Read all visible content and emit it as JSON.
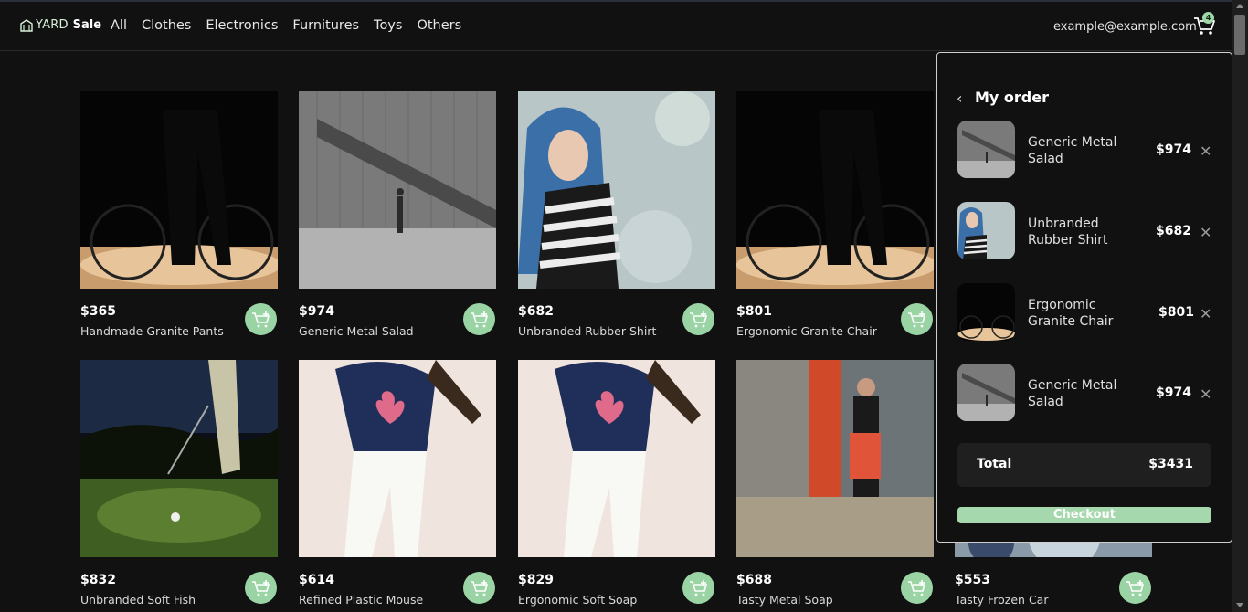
{
  "header": {
    "logo_yard": "YARD",
    "logo_sale": "Sale",
    "nav": [
      "All",
      "Clothes",
      "Electronics",
      "Furnitures",
      "Toys",
      "Others"
    ],
    "email": "example@example.com",
    "cart_count": "4"
  },
  "products": [
    {
      "price": "$365",
      "name": "Handmade Granite Pants",
      "image": "bike"
    },
    {
      "price": "$974",
      "name": "Generic Metal Salad",
      "image": "street"
    },
    {
      "price": "$682",
      "name": "Unbranded Rubber Shirt",
      "image": "scarf"
    },
    {
      "price": "$801",
      "name": "Ergonomic Granite Chair",
      "image": "bike"
    },
    {
      "price": "$832",
      "name": "Unbranded Soft Fish",
      "image": "golf"
    },
    {
      "price": "$614",
      "name": "Refined Plastic Mouse",
      "image": "dancer"
    },
    {
      "price": "$829",
      "name": "Ergonomic Soft Soap",
      "image": "dancer"
    },
    {
      "price": "$688",
      "name": "Tasty Metal Soap",
      "image": "phone"
    },
    {
      "price": "$553",
      "name": "Tasty Frozen Car",
      "image": "blur"
    }
  ],
  "order": {
    "title": "My order",
    "items": [
      {
        "name": "Generic Metal Salad",
        "price": "$974",
        "image": "street"
      },
      {
        "name": "Unbranded Rubber Shirt",
        "price": "$682",
        "image": "scarf"
      },
      {
        "name": "Ergonomic Granite Chair",
        "price": "$801",
        "image": "bike"
      },
      {
        "name": "Generic Metal Salad",
        "price": "$974",
        "image": "street"
      }
    ],
    "total_label": "Total",
    "total_value": "$3431",
    "checkout_label": "Checkout"
  },
  "colors": {
    "accent": "#9ad4a4",
    "background": "#111111"
  }
}
